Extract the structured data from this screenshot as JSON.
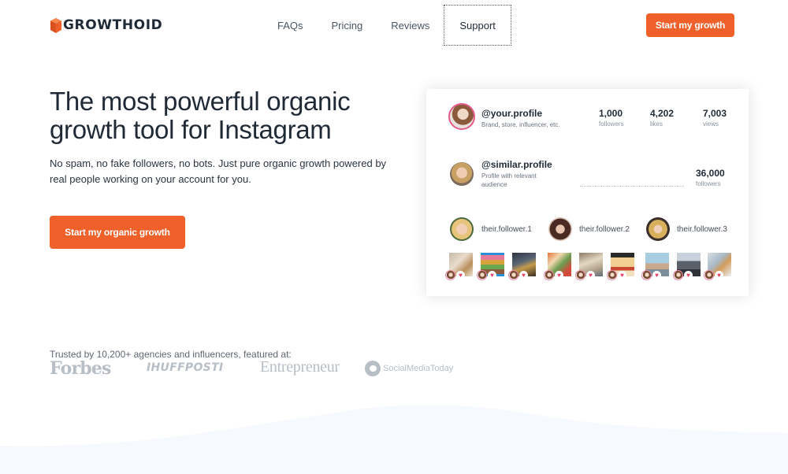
{
  "header": {
    "logo_text": "GROWTHOID",
    "brand_color": "#f0602a",
    "nav": [
      {
        "label": "FAQs",
        "active": false
      },
      {
        "label": "Pricing",
        "active": false
      },
      {
        "label": "Reviews",
        "active": false
      },
      {
        "label": "Support",
        "active": true
      }
    ],
    "cta_label": "Start my growth"
  },
  "hero": {
    "title_line1": "The most powerful organic",
    "title_line2": "growth tool for Instagram",
    "subtitle_line1": "No spam, no fake followers, no bots. Just pure organic growth powered by",
    "subtitle_line2": "real people working on your account for you.",
    "cta_label": "Start my organic growth"
  },
  "card": {
    "your_profile": {
      "handle": "@your.profile",
      "description": "Brand, store, influencer, etc.",
      "stats": [
        {
          "value": "1,000",
          "label": "followers"
        },
        {
          "value": "4,202",
          "label": "likes"
        },
        {
          "value": "7,003",
          "label": "views"
        }
      ]
    },
    "similar_profile": {
      "handle": "@similar.profile",
      "description_line1": "Profile with relevant",
      "description_line2": "audience",
      "followers_value": "36,000",
      "followers_label": "followers"
    },
    "followers": [
      {
        "name": "their.follower.1"
      },
      {
        "name": "their.follower.2"
      },
      {
        "name": "their.follower.3"
      }
    ],
    "posts": [
      {
        "subject": "food-plate",
        "liked": true
      },
      {
        "subject": "macarons",
        "liked": true
      },
      {
        "subject": "grill",
        "liked": true
      },
      {
        "subject": "sushi",
        "liked": true
      },
      {
        "subject": "buffet",
        "liked": true
      },
      {
        "subject": "canapes",
        "liked": true
      },
      {
        "subject": "beach",
        "liked": true
      },
      {
        "subject": "city-street",
        "liked": true
      },
      {
        "subject": "dinner-table",
        "liked": true
      }
    ],
    "heart_glyph": "♥"
  },
  "trusted": {
    "text": "Trusted by 10,200+ agencies and influencers, featured at:",
    "press": [
      "Forbes",
      "IHUFFPOSTI",
      "Entrepreneur",
      "SocialMediaToday"
    ]
  }
}
